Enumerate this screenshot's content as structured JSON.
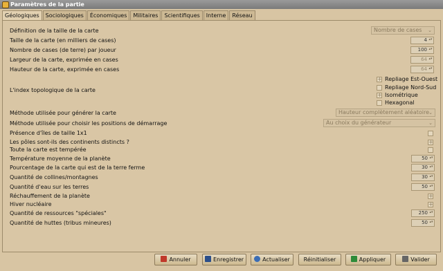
{
  "window": {
    "title": "Paramètres de la partie"
  },
  "tabs": [
    "Géologiques",
    "Sociologiques",
    "Économiques",
    "Militaires",
    "Scientifiques",
    "Interne",
    "Réseau"
  ],
  "settings": {
    "map_size_def": "Définition de la taille de la carte",
    "map_size_def_value": "Nombre de cases",
    "map_size": "Taille de la carte (en milliers de cases)",
    "map_size_value": "4",
    "tiles_per_player": "Nombre de cases (de terre) par joueur",
    "tiles_per_player_value": "100",
    "map_width": "Largeur de la carte, exprimée en cases",
    "map_width_value": "64",
    "map_height": "Hauteur de la carte, exprimée en cases",
    "map_height_value": "64",
    "topology": "L'index topologique de la carte",
    "topology_options": [
      "Repliage Est-Ouest",
      "Repliage Nord-Sud",
      "Isométrique",
      "Hexagonal"
    ],
    "generator": "Méthode utilisée pour générer la carte",
    "generator_value": "Hauteur complètement aléatoire",
    "start_pos": "Méthode utilisée pour choisir les positions de démarrage",
    "start_pos_value": "Au choix du générateur",
    "tinyisles": "Présence d'îles de taille 1x1",
    "separatepoles": "Les pôles sont-ils des continents distincts ?",
    "alltemperate": "Toute la carte est tempérée",
    "temperature": "Température moyenne de la planète",
    "temperature_value": "50",
    "landmass": "Pourcentage de la carte qui est de la terre ferme",
    "landmass_value": "30",
    "steepness": "Quantité de collines/montagnes",
    "steepness_value": "30",
    "wetness": "Quantité d'eau sur les terres",
    "wetness_value": "50",
    "globalwarming": "Réchauffement de la planète",
    "nuclearwinter": "Hiver nucléaire",
    "specials": "Quantité de ressources \"spéciales\"",
    "specials_value": "250",
    "huts": "Quantité de huttes (tribus mineures)",
    "huts_value": "50"
  },
  "buttons": {
    "cancel": "Annuler",
    "save": "Enregistrer",
    "refresh": "Actualiser",
    "reset": "Réinitialiser",
    "apply": "Appliquer",
    "ok": "Valider"
  },
  "colors": {
    "accent": "#d8c5a3",
    "cancel_icon": "#c0392b",
    "save_icon": "#2c4f8a",
    "refresh_icon": "#3b6db5",
    "apply_icon": "#2e8b3a"
  }
}
